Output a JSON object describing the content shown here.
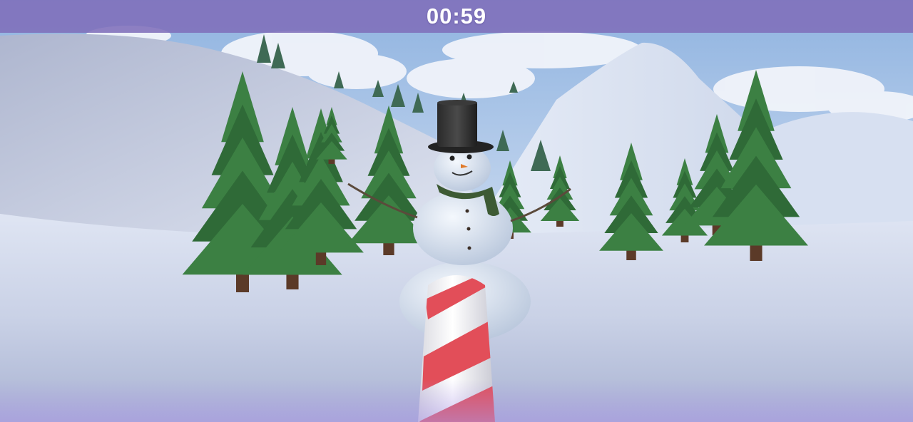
{
  "hud": {
    "timer": "00:59"
  },
  "scene": {
    "sky_color": "#a9c4e6",
    "snow_color": "#e6ebf6",
    "hud_color": "#806eba",
    "objects": [
      "snowman",
      "candy-cane-pole",
      "pine-trees",
      "snowy-hills",
      "clouds"
    ]
  }
}
